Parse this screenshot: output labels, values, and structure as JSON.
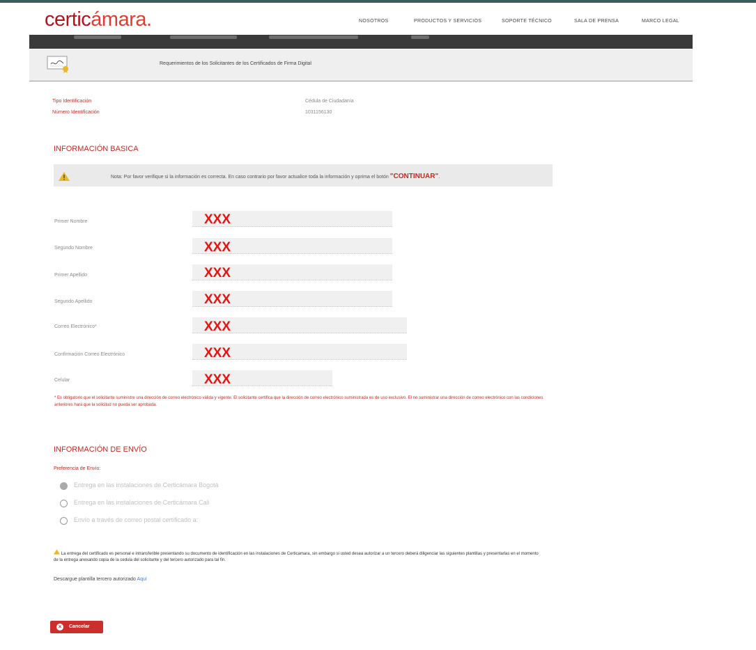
{
  "brand": {
    "logo_part1": "certic",
    "logo_part2": "ámara",
    "logo_dot": "."
  },
  "nav": [
    {
      "label": "NOSOTROS"
    },
    {
      "label": "PRODUCTOS Y SERVICIOS"
    },
    {
      "label": "SOPORTE TÉCNICO"
    },
    {
      "label": "SALA DE PRENSA"
    },
    {
      "label": "MARCO LEGAL"
    }
  ],
  "header": {
    "title": "Requerimientos de los Solicitantes de los Certificados de Firma Digital"
  },
  "identification": {
    "type_label": "Tipo Identificación",
    "type_value": "Cédula de Ciudadanía",
    "number_label": "Número Identificación",
    "number_value": "1031156130"
  },
  "basic_info": {
    "title": "INFORMACIÓN BASICA",
    "note_text": "Nota: Por favor verifique si la información es correcta. En caso contrario por favor actualice toda la información y oprima el botón ",
    "note_button_ref": "\"CONTINUAR\"",
    "note_end": ".",
    "fields": [
      {
        "label": "Primer Nombre",
        "value": "XXX"
      },
      {
        "label": "Segundo Nombre",
        "value": "XXX"
      },
      {
        "label": "Primer Apellido",
        "value": "XXX"
      },
      {
        "label": "Segundo Apellido",
        "value": "XXX"
      },
      {
        "label": "Correo Electrónico*",
        "value": "XXX"
      },
      {
        "label": "Confirmación Correo Electrónico",
        "value": "XXX"
      },
      {
        "label": "Celular",
        "value": "XXX"
      }
    ],
    "disclaimer": "* Es obligatorio que el solicitante suministre una dirección de correo electrónico válida y vigente. El solicitante certifica que la dirección de correo electrónico suministrada es de uso exclusivo. El no suministrar una dirección de correo electrónico con las condiciones anteriores hará que la solicitud no pueda ser aprobada."
  },
  "shipping": {
    "title": "INFORMACIÓN DE ENVÍO",
    "preference_label": "Preferencia de Envío:",
    "options": [
      {
        "label": "Entrega en las instalaciones de Certicámara Bogotá",
        "selected": true
      },
      {
        "label": "Entrega en las instalaciones de Certicámara Cali",
        "selected": false
      },
      {
        "label": "Envío a través de correo postal certificado a:",
        "selected": false
      }
    ],
    "notice": "La entrega del certificado es personal e intransferible presentando su documento de identificación en las instalaciones de Certicamara, sin embargo si usted desea autorizar a un tercero deberá diligenciar las siguientes plantillas y presentarlas en el momento de la entrega anexando copia de la cedula del solicitante y del tercero autorizado para tal fin.",
    "download_text": "Descargue plantilla tercero autorizado ",
    "download_link": "Aquí"
  },
  "actions": {
    "cancel_label": "Cancelar"
  },
  "colors": {
    "brand_red": "#c42b22",
    "value_red": "#e8130f",
    "dark_bar": "#3a3a3a",
    "link_blue": "#3a7fc8"
  }
}
